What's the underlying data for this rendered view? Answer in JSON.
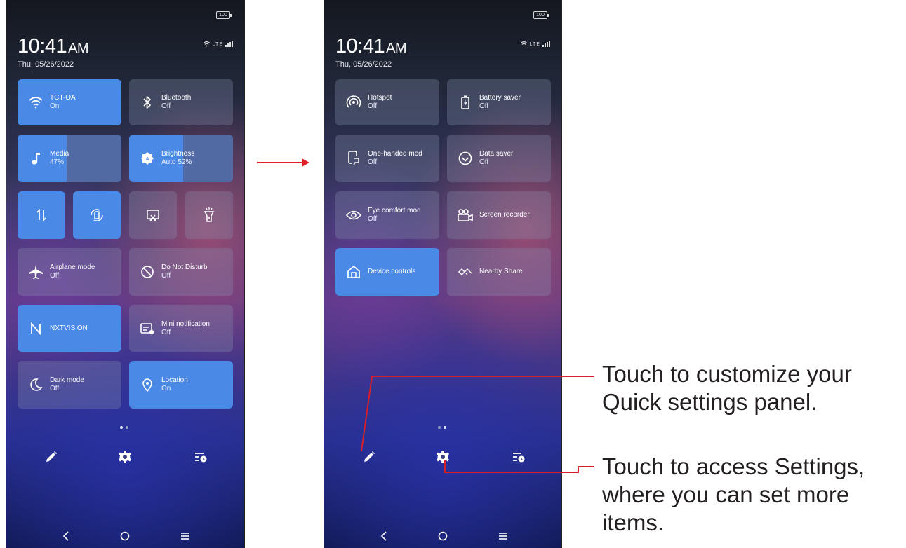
{
  "left_phone": {
    "battery": "100",
    "time": "10:41",
    "ampm": "AM",
    "date": "Thu, 05/26/2022",
    "network": "LTE",
    "tiles": [
      {
        "label": "TCT-OA",
        "sub": "On",
        "icon": "wifi-icon"
      },
      {
        "label": "Bluetooth",
        "sub": "Off",
        "icon": "bluetooth-icon"
      },
      {
        "label": "Media",
        "sub": "47%",
        "icon": "music-note-icon",
        "level": 0.47
      },
      {
        "label": "Brightness",
        "sub": "Auto 52%",
        "icon": "brightness-icon",
        "level": 0.52
      },
      {
        "label": "Airplane mode",
        "sub": "Off",
        "icon": "airplane-icon"
      },
      {
        "label": "Do Not Disturb",
        "sub": "Off",
        "icon": "do-not-disturb-icon"
      },
      {
        "label": "NXTVISION",
        "sub": "",
        "icon": "nxtvision-icon"
      },
      {
        "label": "Mini notification",
        "sub": "Off",
        "icon": "mini-notification-icon"
      },
      {
        "label": "Dark mode",
        "sub": "Off",
        "icon": "moon-icon"
      },
      {
        "label": "Location",
        "sub": "On",
        "icon": "location-icon"
      }
    ],
    "small_tiles": [
      "data-transfer-icon",
      "auto-rotate-icon",
      "screenshot-icon",
      "flashlight-icon"
    ]
  },
  "right_phone": {
    "battery": "100",
    "time": "10:41",
    "ampm": "AM",
    "date": "Thu, 05/26/2022",
    "network": "LTE",
    "tiles": [
      {
        "label": "Hotspot",
        "sub": "Off",
        "icon": "hotspot-icon"
      },
      {
        "label": "Battery saver",
        "sub": "Off",
        "icon": "battery-saver-icon"
      },
      {
        "label": "One-handed mod",
        "sub": "Off",
        "icon": "one-handed-icon"
      },
      {
        "label": "Data saver",
        "sub": "Off",
        "icon": "data-saver-icon"
      },
      {
        "label": "Eye comfort mod",
        "sub": "Off",
        "icon": "eye-icon"
      },
      {
        "label": "Screen recorder",
        "sub": "",
        "icon": "screen-recorder-icon"
      },
      {
        "label": "Device controls",
        "sub": "",
        "icon": "home-icon"
      },
      {
        "label": "Nearby Share",
        "sub": "",
        "icon": "nearby-share-icon"
      }
    ]
  },
  "bottom_icons": [
    "pencil-icon",
    "gear-icon",
    "notification-history-icon"
  ],
  "nav_icons": [
    "back-icon",
    "home-circle-icon",
    "menu-icon"
  ],
  "callouts": {
    "customize": "Touch to customize your Quick settings panel.",
    "customize_line1": "Touch to customize your",
    "customize_line2": "Quick settings panel.",
    "settings_line1": "Touch to access Settings,",
    "settings_line2": "where you can set more",
    "settings_line3": "items."
  },
  "colors": {
    "tile_active": "#4a89e6",
    "callout_red": "#d81e2a"
  }
}
